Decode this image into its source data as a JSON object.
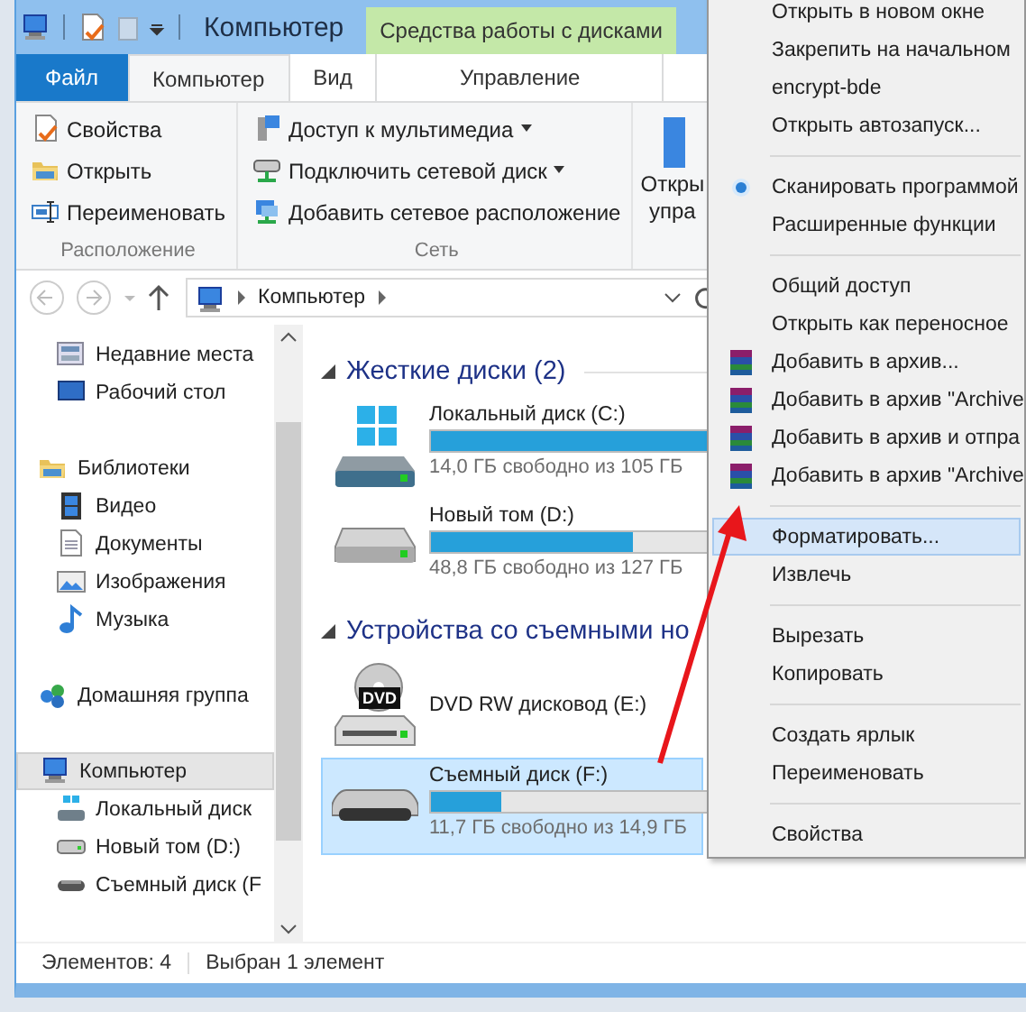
{
  "window": {
    "title": "Компьютер",
    "context_tab": "Средства работы с дисками"
  },
  "ribbon_tabs": [
    {
      "label": "Файл",
      "kind": "file",
      "selected": false
    },
    {
      "label": "Компьютер",
      "kind": "tab",
      "selected": true
    },
    {
      "label": "Вид",
      "kind": "tab",
      "selected": false
    },
    {
      "label": "Управление",
      "kind": "context",
      "selected": false
    }
  ],
  "ribbon_groups": [
    {
      "label": "Расположение",
      "commands": [
        {
          "label": "Свойства"
        },
        {
          "label": "Открыть"
        },
        {
          "label": "Переименовать"
        }
      ]
    },
    {
      "label": "Сеть",
      "commands": [
        {
          "label": "Доступ к мультимедиа",
          "dropdown": true
        },
        {
          "label": "Подключить сетевой диск",
          "dropdown": true
        },
        {
          "label": "Добавить сетевое расположение",
          "dropdown": false
        }
      ]
    }
  ],
  "ribbon_cut_command": {
    "lines": [
      "Откры",
      "упра"
    ]
  },
  "address": {
    "crumbs": [
      "Компьютер"
    ]
  },
  "nav_groups": [
    {
      "children": [
        {
          "label": "Недавние места"
        },
        {
          "label": "Рабочий стол"
        }
      ]
    },
    {
      "label": "Библиотеки",
      "selected": false,
      "children": [
        {
          "label": "Видео"
        },
        {
          "label": "Документы"
        },
        {
          "label": "Изображения"
        },
        {
          "label": "Музыка"
        }
      ]
    },
    {
      "label": "Домашняя группа",
      "selected": false
    },
    {
      "label": "Компьютер",
      "selected": true,
      "children": [
        {
          "label": "Локальный диск"
        },
        {
          "label": "Новый том (D:)"
        },
        {
          "label": "Съемный диск (F"
        }
      ]
    }
  ],
  "sections": [
    {
      "title": "Жесткие диски (2)",
      "expanded": true,
      "drives": [
        {
          "kind": "system",
          "name": "Локальный диск (C:)",
          "level": 0.87,
          "free": "14,0 ГБ свободно из 105 ГБ",
          "selected": false
        },
        {
          "kind": "hdd",
          "name": "Новый том (D:)",
          "level": 0.62,
          "free": "48,8 ГБ свободно из 127 ГБ",
          "selected": false
        }
      ]
    },
    {
      "title": "Устройства со съемными но",
      "expanded": true,
      "drives": [
        {
          "kind": "dvd",
          "badge": "DVD",
          "name": "DVD RW дисковод (E:)",
          "selected": false
        },
        {
          "kind": "usb",
          "name": "Съемный диск (F:)",
          "level": 0.215,
          "free": "11,7 ГБ свободно из 14,9 ГБ",
          "selected": true
        }
      ]
    }
  ],
  "status_bar": {
    "count": "Элементов: 4",
    "selection": "Выбран 1 элемент"
  },
  "context_menu": {
    "groups": [
      [
        {
          "label": "Открыть в новом окне",
          "kind": "plain",
          "selected": false
        },
        {
          "label": "Закрепить на начальном",
          "kind": "plain",
          "selected": false
        },
        {
          "label": "encrypt-bde",
          "kind": "plain",
          "selected": false
        },
        {
          "label": "Открыть автозапуск...",
          "kind": "plain",
          "selected": false
        }
      ],
      [
        {
          "label": "Сканировать программой",
          "kind": "radio",
          "checked": true,
          "selected": false
        },
        {
          "label": "Расширенные функции",
          "kind": "plain",
          "selected": false
        }
      ],
      [
        {
          "label": "Общий доступ",
          "kind": "plain",
          "selected": false
        },
        {
          "label": "Открыть как переносное",
          "kind": "plain",
          "selected": false
        },
        {
          "label": "Добавить в архив...",
          "kind": "archive",
          "selected": false
        },
        {
          "label": "Добавить в архив \"Archive",
          "kind": "archive",
          "selected": false
        },
        {
          "label": "Добавить в архив и отпра",
          "kind": "archive",
          "selected": false
        },
        {
          "label": "Добавить в архив \"Archive",
          "kind": "archive",
          "selected": false
        }
      ],
      [
        {
          "label": "Форматировать...",
          "kind": "plain",
          "selected": true
        },
        {
          "label": "Извлечь",
          "kind": "plain",
          "selected": false
        }
      ],
      [
        {
          "label": "Вырезать",
          "kind": "plain",
          "selected": false
        },
        {
          "label": "Копировать",
          "kind": "plain",
          "selected": false
        }
      ],
      [
        {
          "label": "Создать ярлык",
          "kind": "plain",
          "selected": false
        },
        {
          "label": "Переименовать",
          "kind": "plain",
          "selected": false
        }
      ],
      [
        {
          "label": "Свойства",
          "kind": "plain",
          "selected": false
        }
      ]
    ]
  }
}
